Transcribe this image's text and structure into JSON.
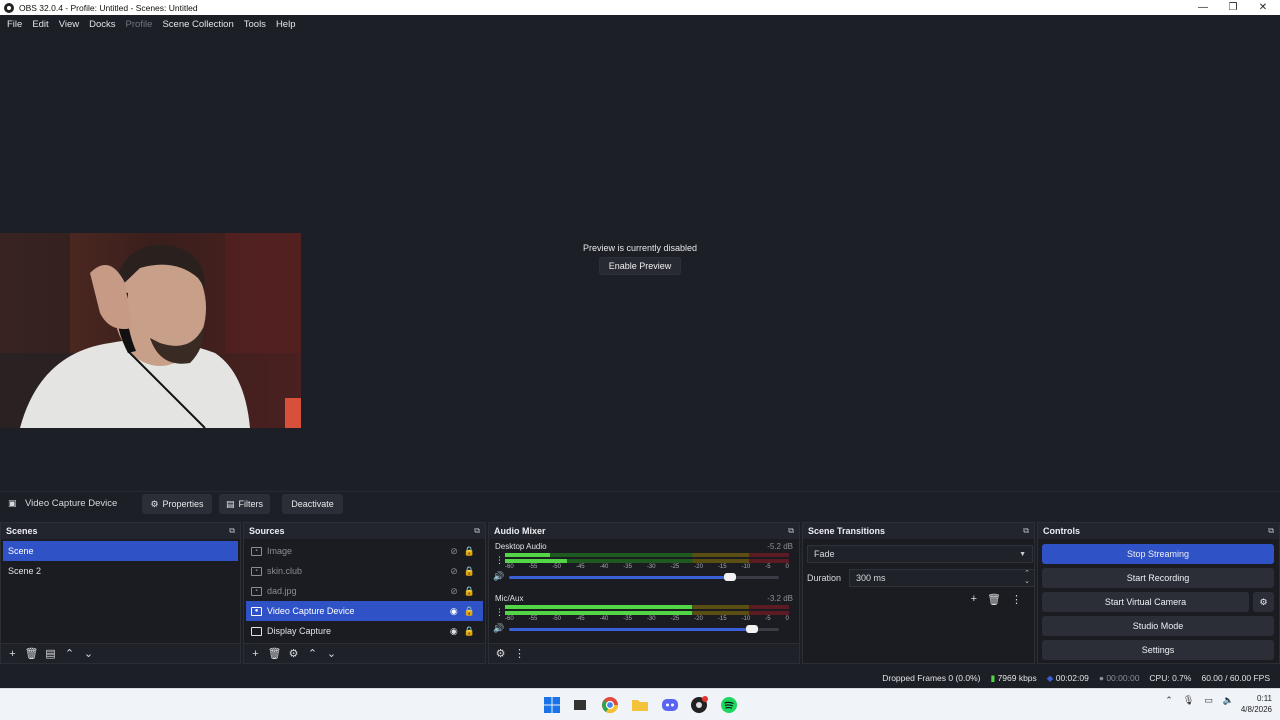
{
  "window": {
    "title": "OBS 32.0.4 - Profile: Untitled - Scenes: Untitled",
    "controls": [
      "—",
      "❐",
      "✕"
    ]
  },
  "menu": [
    "File",
    "Edit",
    "View",
    "Docks",
    "Profile",
    "Scene Collection",
    "Tools",
    "Help"
  ],
  "preview": {
    "message": "Preview is currently disabled",
    "button": "Enable Preview"
  },
  "source_toolbar": {
    "source_name": "Video Capture Device",
    "properties": "Properties",
    "filters": "Filters",
    "deactivate": "Deactivate"
  },
  "scenes": {
    "title": "Scenes",
    "items": [
      "Scene",
      "Scene 2"
    ]
  },
  "sources": {
    "title": "Sources",
    "items": [
      {
        "name": "Image",
        "hidden": true
      },
      {
        "name": "skin.club",
        "hidden": true
      },
      {
        "name": "dad.jpg",
        "hidden": true
      },
      {
        "name": "Video Capture Device",
        "hidden": false
      },
      {
        "name": "Display Capture",
        "hidden": false
      }
    ]
  },
  "audio_mixer": {
    "title": "Audio Mixer",
    "scale": [
      "-60",
      "-55",
      "-50",
      "-45",
      "-40",
      "-35",
      "-30",
      "-25",
      "-20",
      "-15",
      "-10",
      "-5",
      "0"
    ],
    "channels": [
      {
        "name": "Desktop Audio",
        "db": "-5.2 dB",
        "level_top": 0.16,
        "level_bottom": 0.22,
        "volume": 0.82
      },
      {
        "name": "Mic/Aux",
        "db": "-3.2 dB",
        "level_top": 0.66,
        "level_bottom": 0.66,
        "volume": 0.9
      }
    ]
  },
  "transitions": {
    "title": "Scene Transitions",
    "selected": "Fade",
    "duration_label": "Duration",
    "duration_value": "300 ms"
  },
  "controls": {
    "title": "Controls",
    "stop_streaming": "Stop Streaming",
    "start_recording": "Start Recording",
    "start_virtual_camera": "Start Virtual Camera",
    "studio_mode": "Studio Mode",
    "settings": "Settings"
  },
  "status": {
    "dropped_frames": "Dropped Frames 0 (0.0%)",
    "bitrate": "7969 kbps",
    "stream_time": "00:02:09",
    "rec_time": "00:00:00",
    "cpu": "CPU: 0.7%",
    "fps": "60.00 / 60.00 FPS"
  },
  "taskbar": {
    "time": "0:11",
    "date": "4/8/2026"
  },
  "colors": {
    "accent": "#2f53c7",
    "background": "#1d1f26",
    "meter_green": "#53d646"
  }
}
